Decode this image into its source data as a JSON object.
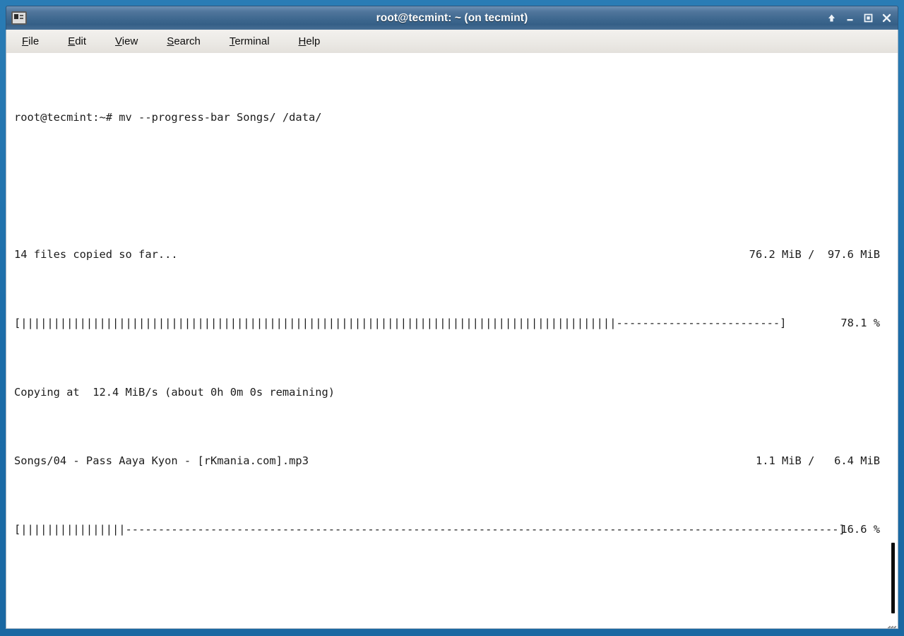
{
  "window": {
    "title": "root@tecmint: ~ (on tecmint)",
    "icon": "terminal-icon",
    "buttons": {
      "shade_label": "Shade",
      "minimize_label": "Minimize",
      "maximize_label": "Maximize",
      "close_label": "Close"
    }
  },
  "menubar": {
    "items": [
      {
        "label": "File",
        "mnemonic": "F",
        "rest": "ile"
      },
      {
        "label": "Edit",
        "mnemonic": "E",
        "rest": "dit"
      },
      {
        "label": "View",
        "mnemonic": "V",
        "rest": "iew"
      },
      {
        "label": "Search",
        "mnemonic": "S",
        "rest": "earch"
      },
      {
        "label": "Terminal",
        "mnemonic": "T",
        "rest": "erminal"
      },
      {
        "label": "Help",
        "mnemonic": "H",
        "rest": "elp"
      }
    ]
  },
  "terminal": {
    "prompt": "root@tecmint:~# ",
    "command": "mv --progress-bar Songs/ /data/",
    "command_line": "root@tecmint:~# mv --progress-bar Songs/ /data/",
    "blank_line": " ",
    "overall": {
      "status": "14 files copied so far...",
      "files_done": 14,
      "transferred": "76.2 MiB",
      "total": "97.6 MiB",
      "size_line": "76.2 MiB /  97.6 MiB",
      "percent_label": "78.1 %",
      "percent_value": 78.1,
      "bar_filled": "[|||||||||||||||||||||||||||||||||||||||||||||||||||||||||||||||||||||||||||||||||||||||||||",
      "bar_empty": "-------------------------]",
      "speed_line": "Copying at  12.4 MiB/s (about 0h 0m 0s remaining)",
      "speed": "12.4 MiB/s",
      "eta": "0h 0m 0s"
    },
    "current_file": {
      "name": "Songs/04 - Pass Aaya Kyon - [rKmania.com].mp3",
      "transferred": "1.1 MiB",
      "total": "6.4 MiB",
      "size_line": "1.1 MiB /   6.4 MiB",
      "percent_label": "16.6 %",
      "percent_value": 16.6,
      "bar_filled": "[||||||||||||||||",
      "bar_empty": "-------------------------------------------------------------------------------------------------------------]"
    }
  },
  "colors": {
    "window_border": "#1b6ca8",
    "titlebar": "#3e688f",
    "menubar": "#eceae6",
    "terminal_bg": "#ffffff",
    "terminal_fg": "#1c1c1c",
    "scrollbar_thumb": "#0b0b0b"
  }
}
